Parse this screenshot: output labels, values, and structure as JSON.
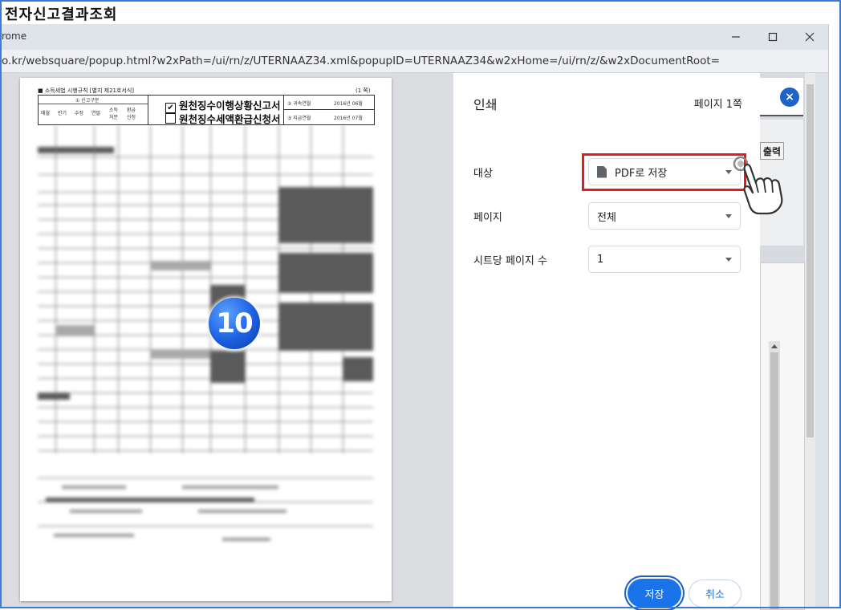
{
  "page_heading": "전자신고결과조회",
  "window": {
    "title": "rome",
    "address": "o.kr/websquare/popup.html?w2xPath=/ui/rn/z/UTERNAAZ34.xml&popupID=UTERNAAZ34&w2xHome=/ui/rn/z/&w2xDocumentRoot=",
    "controls": {
      "minimize": "—",
      "maximize": "☐",
      "close": "✕"
    }
  },
  "preview": {
    "form_note": "■ 소득세법 시행규칙 [별지 제21호서식]",
    "form_page": "(1 쪽)",
    "form_title_1": "원천징수이행상황신고서",
    "form_title_2": "원천징수세액환급신청서",
    "check_mark": "✔",
    "cells": {
      "report_type": "① 신고구분",
      "monthly": "매월",
      "half": "반기",
      "amend": "수정",
      "yearend": "연말",
      "income_disposal": "소득\n처분",
      "refund_apply": "환급\n신청",
      "belong_label": "② 귀속연월",
      "belong_value": "2016년 06월",
      "pay_label": "③ 지급연월",
      "pay_value": "2016년 07월"
    },
    "step_badge": "10"
  },
  "print_panel": {
    "title": "인쇄",
    "page_count": "페이지 1쪽",
    "destination_label": "대상",
    "destination_value": "PDF로 저장",
    "pages_label": "페이지",
    "pages_value": "전체",
    "per_sheet_label": "시트당 페이지 수",
    "per_sheet_value": "1",
    "save_button": "저장",
    "cancel_button": "취소"
  },
  "background_page": {
    "close_glyph": "×",
    "print_button_partial": "출력"
  },
  "colors": {
    "accent": "#1a73e8",
    "highlight": "#e41b1b",
    "outer_border": "#3a7bd5",
    "badge": "#1c5fe0"
  }
}
